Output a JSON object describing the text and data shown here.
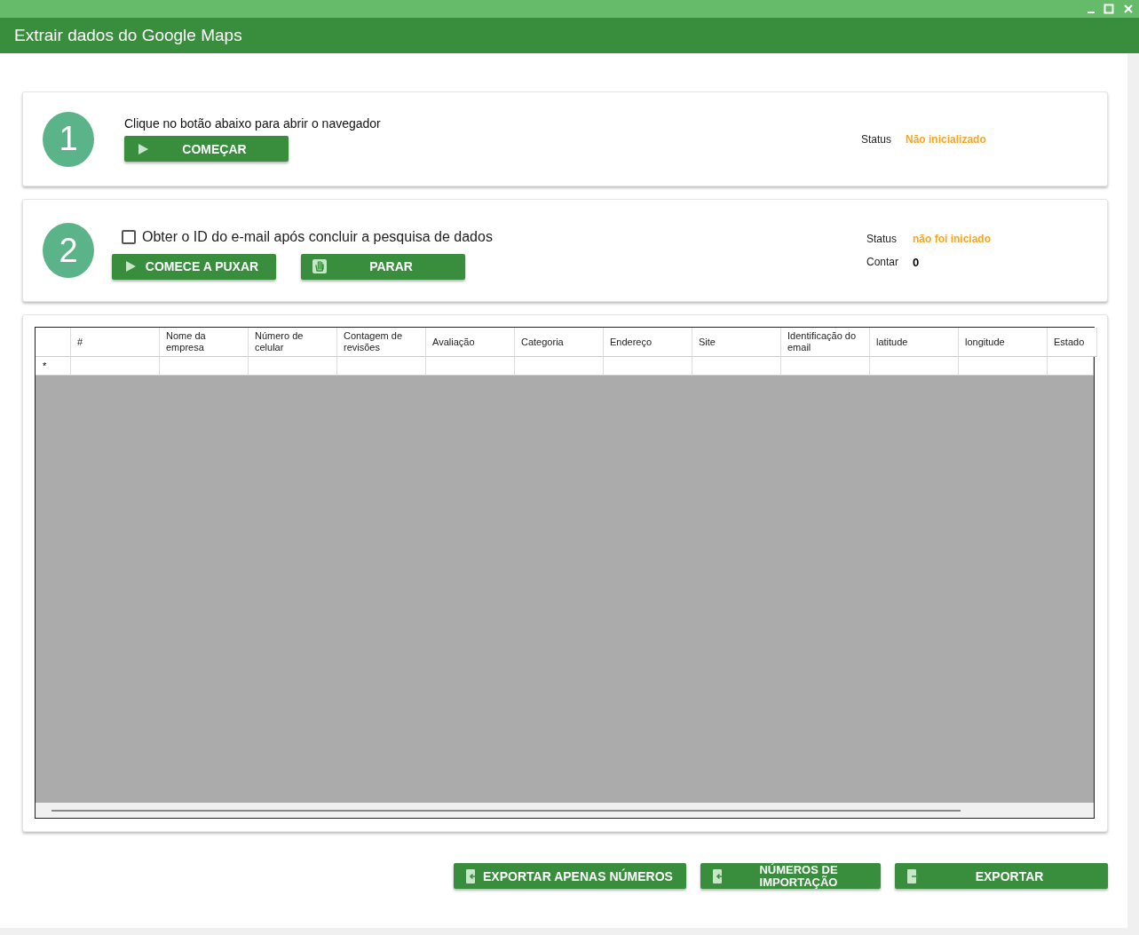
{
  "window": {
    "title": "Extrair dados do Google Maps"
  },
  "step1": {
    "number": "1",
    "instruction": "Clique no botão abaixo para abrir o navegador",
    "button": "COMEÇAR",
    "status_label": "Status",
    "status_value": "Não inicializado"
  },
  "step2": {
    "number": "2",
    "checkbox": {
      "label": "Obter o ID do e-mail após concluir a pesquisa de dados",
      "checked": false
    },
    "buttons": [
      {
        "kind": "play",
        "label": "COMECE A PUXAR"
      },
      {
        "kind": "stop",
        "label": "PARAR"
      }
    ],
    "status_label": "Status",
    "status_value": "não foi iniciado",
    "count_label": "Contar",
    "count_value": "0"
  },
  "table": {
    "columns": [
      "#",
      "Nome da empresa",
      "Número de celular",
      "Contagem de revisões",
      "Avaliação",
      "Categoria",
      "Endereço",
      "Site",
      "Identificação do email",
      "latitude",
      "longitude",
      "Estado"
    ],
    "new_row_marker": "*"
  },
  "footer_buttons": [
    {
      "kind": "import",
      "label": "EXPORTAR APENAS NÚMEROS"
    },
    {
      "kind": "import",
      "label": "NÚMEROS DE IMPORTAÇÃO"
    },
    {
      "kind": "export",
      "label": "EXPORTAR"
    }
  ]
}
